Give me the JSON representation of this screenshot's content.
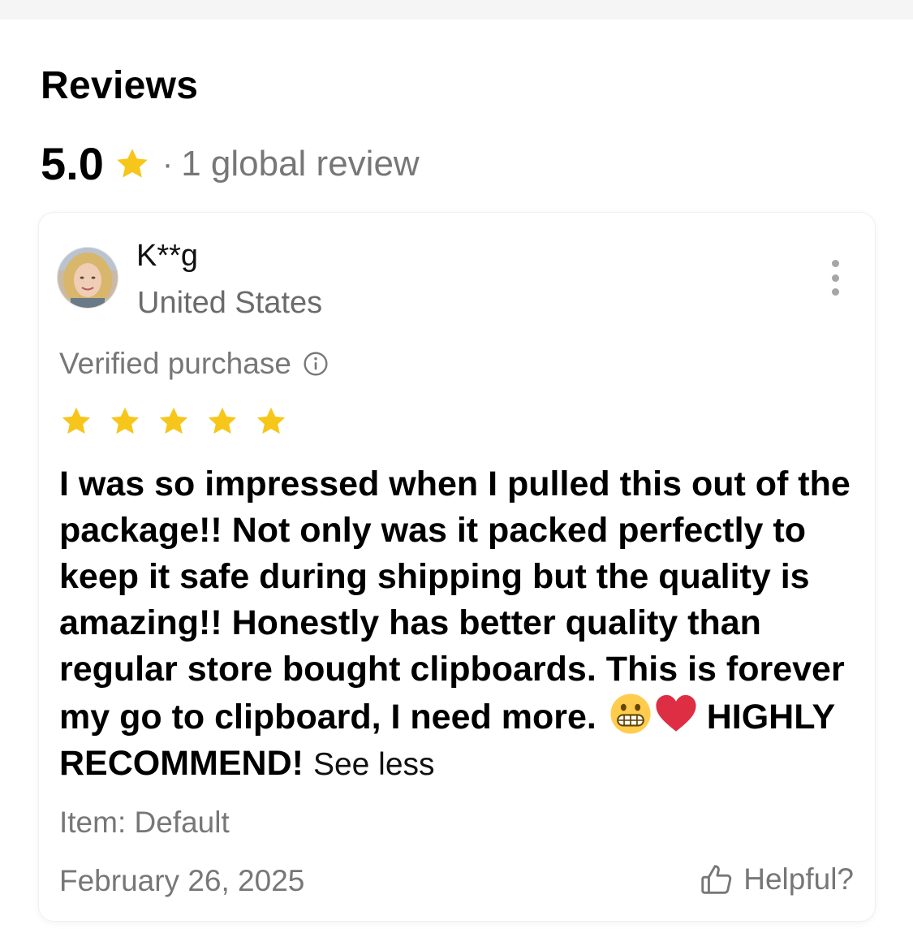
{
  "reviews": {
    "title": "Reviews",
    "summary": {
      "rating": "5.0",
      "separator": "·",
      "count_label": "1 global review",
      "star_color": "#F7C61B"
    }
  },
  "review": {
    "reviewer_name": "K**g",
    "reviewer_country": "United States",
    "avatar_icon": "user-photo",
    "more_icon": "vertical-ellipsis-icon",
    "verified_label": "Verified purchase",
    "verified_icon": "info-circle-icon",
    "rating": 5,
    "rating_max": 5,
    "text": "I was so impressed when I pulled this out of the package!! Not only was it packed perfectly to keep it safe during shipping but the quality is amazing!! Honestly has better quality than regular store bought clipboards. This is forever my go to clipboard, I need more.",
    "emojis": [
      "grimacing-face-emoji",
      "red-heart-emoji"
    ],
    "text_tail": "HIGHLY RECOMMEND!",
    "see_less_label": "See less",
    "item_label": "Item: Default",
    "date": "February 26, 2025",
    "helpful_label": "Helpful?",
    "helpful_icon": "thumbs-up-icon"
  },
  "colors": {
    "star": "#F7C61B",
    "secondary_text": "#777777",
    "primary_text": "#000000"
  }
}
